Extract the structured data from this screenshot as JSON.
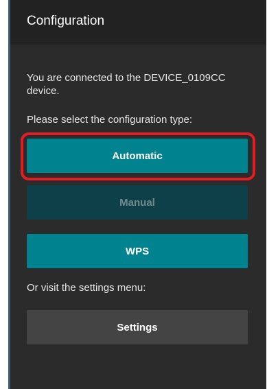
{
  "app": {
    "title": "Configuration"
  },
  "main": {
    "connected_text": "You are connected to the DEVICE_0109CC device.",
    "select_prompt": "Please select the configuration type:",
    "buttons": {
      "automatic": "Automatic",
      "manual": "Manual",
      "wps": "WPS"
    },
    "settings_prompt": "Or visit the settings menu:",
    "settings_button": "Settings"
  },
  "colors": {
    "accent": "#00838f",
    "disabled": "#0e4049",
    "neutral_button": "#444444",
    "highlight": "#e01e24",
    "background": "#2b2b2b",
    "appbar": "#222222"
  }
}
